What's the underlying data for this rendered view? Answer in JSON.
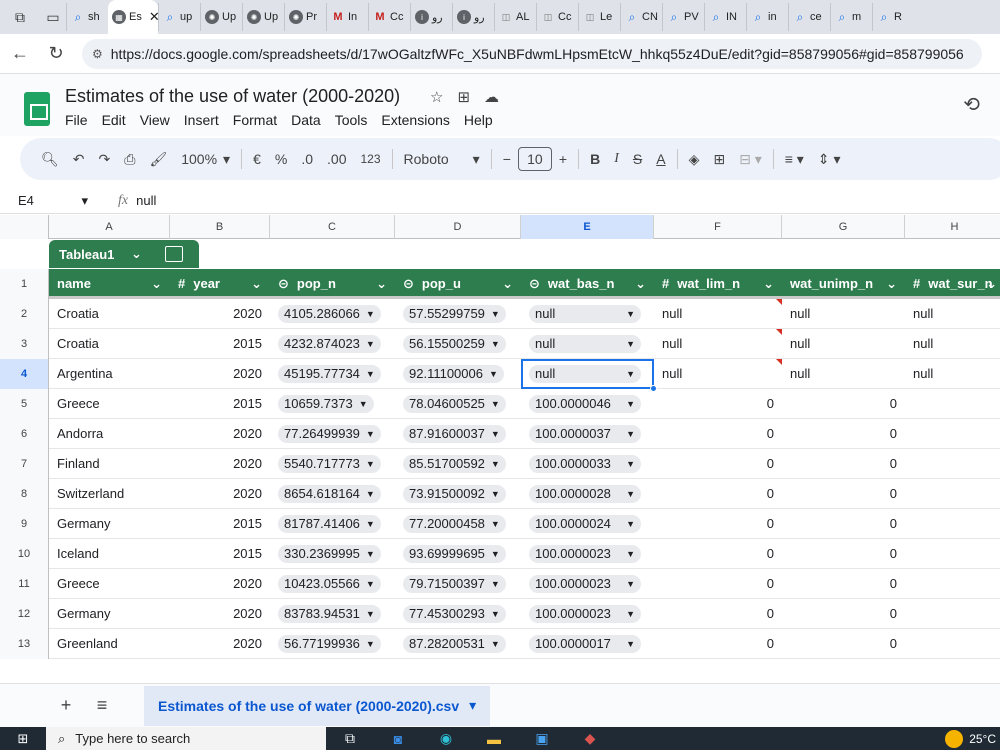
{
  "browser": {
    "tabs": [
      {
        "label": "sh",
        "icon": "search-icon"
      },
      {
        "label": "Es",
        "icon": "sheets-icon",
        "active": true
      },
      {
        "label": "up",
        "icon": "search-icon"
      },
      {
        "label": "Up",
        "icon": "chatgpt-icon"
      },
      {
        "label": "Up",
        "icon": "chatgpt-icon"
      },
      {
        "label": "Pr",
        "icon": "chatgpt-icon"
      },
      {
        "label": "In",
        "icon": "gmail-icon"
      },
      {
        "label": "Cc",
        "icon": "gmail-icon"
      },
      {
        "label": "ﺭﻭ",
        "icon": "info-icon"
      },
      {
        "label": "ﺭﻭ",
        "icon": "info-icon"
      },
      {
        "label": "AL",
        "icon": "document-icon"
      },
      {
        "label": "Cc",
        "icon": "document-icon"
      },
      {
        "label": "Le",
        "icon": "document-icon"
      },
      {
        "label": "CN",
        "icon": "search-icon"
      },
      {
        "label": "PV",
        "icon": "search-icon"
      },
      {
        "label": "IN",
        "icon": "search-icon"
      },
      {
        "label": "in",
        "icon": "search-icon"
      },
      {
        "label": "ce",
        "icon": "search-icon"
      },
      {
        "label": "m",
        "icon": "search-icon"
      },
      {
        "label": "R",
        "icon": "search-icon"
      }
    ],
    "url": "https://docs.google.com/spreadsheets/d/17wOGaltzfWFc_X5uNBFdwmLHpsmEtcW_hhkq55z4DuE/edit?gid=858799056#gid=858799056"
  },
  "sheets": {
    "title": "Estimates of the use of water (2000-2020)",
    "menu": [
      "File",
      "Edit",
      "View",
      "Insert",
      "Format",
      "Data",
      "Tools",
      "Extensions",
      "Help"
    ],
    "toolbar": {
      "zoom": "100%",
      "currency": "€",
      "percent": "%",
      "dec_decrease": ".0",
      "dec_increase": ".00",
      "number_format": "123",
      "font": "Roboto",
      "font_size": "10",
      "bold": "B",
      "italic": "I",
      "strike": "S",
      "text_color": "A"
    },
    "formula_bar": {
      "cell_ref": "E4",
      "fx": "fx",
      "value": "null"
    },
    "columns": [
      "A",
      "B",
      "C",
      "D",
      "E",
      "F",
      "G",
      "H"
    ],
    "table_name": "Tableau1",
    "headers": [
      {
        "label": "name",
        "type": ""
      },
      {
        "label": "year",
        "type": "#"
      },
      {
        "label": "pop_n",
        "type": "⊝"
      },
      {
        "label": "pop_u",
        "type": "⊝"
      },
      {
        "label": "wat_bas_n",
        "type": "⊝"
      },
      {
        "label": "wat_lim_n",
        "type": "#"
      },
      {
        "label": "wat_unimp_n",
        "type": ""
      },
      {
        "label": "wat_sur_n",
        "type": "#"
      }
    ],
    "rows": [
      {
        "n": "2",
        "name": "Croatia",
        "year": "2020",
        "pop_n": "4105.286066",
        "pop_u": "57.55299759",
        "wat_bas_n": "null",
        "wat_lim_n": "null",
        "wat_unimp_n": "null",
        "wat_sur_n": "null"
      },
      {
        "n": "3",
        "name": "Croatia",
        "year": "2015",
        "pop_n": "4232.874023",
        "pop_u": "56.15500259",
        "wat_bas_n": "null",
        "wat_lim_n": "null",
        "wat_unimp_n": "null",
        "wat_sur_n": "null"
      },
      {
        "n": "4",
        "name": "Argentina",
        "year": "2020",
        "pop_n": "45195.77734",
        "pop_u": "92.11100006",
        "wat_bas_n": "null",
        "wat_lim_n": "null",
        "wat_unimp_n": "null",
        "wat_sur_n": "null"
      },
      {
        "n": "5",
        "name": "Greece",
        "year": "2015",
        "pop_n": "10659.7373",
        "pop_u": "78.04600525",
        "wat_bas_n": "100.0000046",
        "wat_lim_n": "0",
        "wat_unimp_n": "0",
        "wat_sur_n": ""
      },
      {
        "n": "6",
        "name": "Andorra",
        "year": "2020",
        "pop_n": "77.26499939",
        "pop_u": "87.91600037",
        "wat_bas_n": "100.0000037",
        "wat_lim_n": "0",
        "wat_unimp_n": "0",
        "wat_sur_n": ""
      },
      {
        "n": "7",
        "name": "Finland",
        "year": "2020",
        "pop_n": "5540.717773",
        "pop_u": "85.51700592",
        "wat_bas_n": "100.0000033",
        "wat_lim_n": "0",
        "wat_unimp_n": "0",
        "wat_sur_n": ""
      },
      {
        "n": "8",
        "name": "Switzerland",
        "year": "2020",
        "pop_n": "8654.618164",
        "pop_u": "73.91500092",
        "wat_bas_n": "100.0000028",
        "wat_lim_n": "0",
        "wat_unimp_n": "0",
        "wat_sur_n": ""
      },
      {
        "n": "9",
        "name": "Germany",
        "year": "2015",
        "pop_n": "81787.41406",
        "pop_u": "77.20000458",
        "wat_bas_n": "100.0000024",
        "wat_lim_n": "0",
        "wat_unimp_n": "0",
        "wat_sur_n": ""
      },
      {
        "n": "10",
        "name": "Iceland",
        "year": "2015",
        "pop_n": "330.2369995",
        "pop_u": "93.69999695",
        "wat_bas_n": "100.0000023",
        "wat_lim_n": "0",
        "wat_unimp_n": "0",
        "wat_sur_n": ""
      },
      {
        "n": "11",
        "name": "Greece",
        "year": "2020",
        "pop_n": "10423.05566",
        "pop_u": "79.71500397",
        "wat_bas_n": "100.0000023",
        "wat_lim_n": "0",
        "wat_unimp_n": "0",
        "wat_sur_n": ""
      },
      {
        "n": "12",
        "name": "Germany",
        "year": "2020",
        "pop_n": "83783.94531",
        "pop_u": "77.45300293",
        "wat_bas_n": "100.0000023",
        "wat_lim_n": "0",
        "wat_unimp_n": "0",
        "wat_sur_n": ""
      },
      {
        "n": "13",
        "name": "Greenland",
        "year": "2020",
        "pop_n": "56.77199936",
        "pop_u": "87.28200531",
        "wat_bas_n": "100.0000017",
        "wat_lim_n": "0",
        "wat_unimp_n": "0",
        "wat_sur_n": ""
      }
    ],
    "sheet_tab": "Estimates of the use of water (2000-2020).csv",
    "header_row_num": "1"
  },
  "taskbar": {
    "search_placeholder": "Type here to search",
    "weather": "25°C"
  }
}
